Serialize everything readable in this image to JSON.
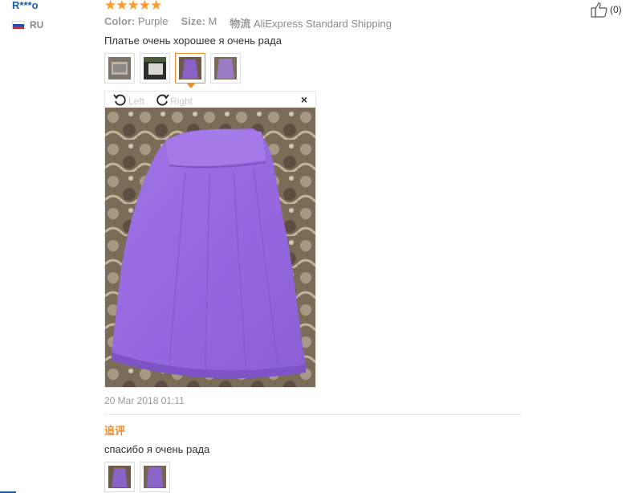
{
  "reviewer": {
    "name": "R***o",
    "country": "RU",
    "flag_icon": "russia-flag-icon"
  },
  "rating": {
    "stars": "★★★★★",
    "count": 5,
    "color": "#ff9a2a"
  },
  "like": {
    "icon": "thumbs-up-icon",
    "count": "(0)"
  },
  "meta": {
    "color_label": "Color:",
    "color_value": "Purple",
    "size_label": "Size:",
    "size_value": "M",
    "shipping_label": "物流",
    "shipping_value": "AliExpress Standard Shipping"
  },
  "review": {
    "text": "Платье очень хорошее я очень рада",
    "date": "20 Mar 2018 01:11"
  },
  "viewer": {
    "rotate_left": "Left",
    "rotate_right": "Right",
    "close": "×",
    "active_index": 2
  },
  "thumbnails": [
    {
      "name": "photo-thumbnail-1",
      "tone": "#9a8f86"
    },
    {
      "name": "photo-thumbnail-2",
      "tone": "#3c3f3a"
    },
    {
      "name": "photo-thumbnail-3",
      "tone": "#8a62c6"
    },
    {
      "name": "photo-thumbnail-4",
      "tone": "#9a7cc6"
    }
  ],
  "followup": {
    "title": "追评",
    "text": "спасибо я очень рада",
    "thumbnails": [
      {
        "tone": "#8a62c6"
      },
      {
        "tone": "#8b66c8"
      }
    ]
  },
  "colors": {
    "accent": "#f28b28",
    "link": "#1f5fa8",
    "dress": "#9b6ae0"
  }
}
